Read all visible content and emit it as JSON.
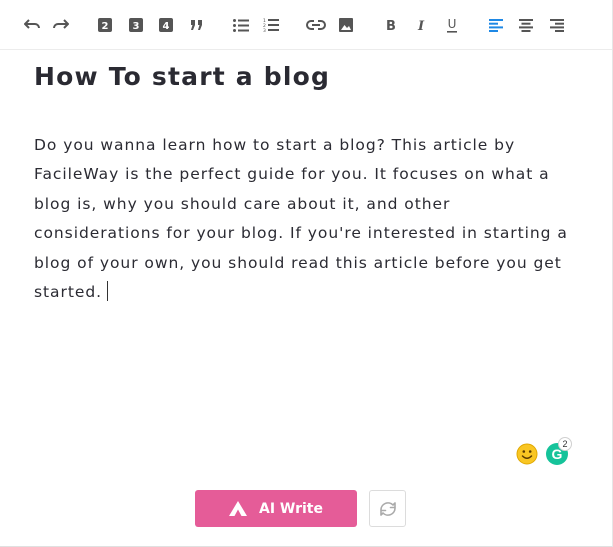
{
  "toolbar": {
    "buttons": [
      {
        "name": "undo-icon"
      },
      {
        "name": "redo-icon"
      },
      {
        "name": "heading-2-icon",
        "glyph": "2"
      },
      {
        "name": "heading-3-icon",
        "glyph": "3"
      },
      {
        "name": "heading-4-icon",
        "glyph": "4"
      },
      {
        "name": "blockquote-icon"
      },
      {
        "name": "bullet-list-icon"
      },
      {
        "name": "numbered-list-icon"
      },
      {
        "name": "link-icon"
      },
      {
        "name": "image-icon"
      },
      {
        "name": "bold-icon",
        "glyph": "B"
      },
      {
        "name": "italic-icon",
        "glyph": "I"
      },
      {
        "name": "underline-icon",
        "glyph": "U"
      },
      {
        "name": "align-left-icon",
        "active": true
      },
      {
        "name": "align-center-icon"
      },
      {
        "name": "align-right-icon"
      }
    ],
    "icon_color": "#555555",
    "active_color": "#1e88e5"
  },
  "editor": {
    "title": "How To start a blog",
    "body": "Do you wanna learn how to start a blog? This article by FacileWay is the perfect guide for you. It focuses on what a blog is, why you should care about it, and other considerations for your blog. If you're interested in starting a blog of your own, you should read this article before you get started."
  },
  "grammarly": {
    "letter": "G",
    "badge_count": "2",
    "color": "#15c39a"
  },
  "actions": {
    "ai_write_label": "AI Write",
    "ai_write_color": "#e55c98"
  }
}
